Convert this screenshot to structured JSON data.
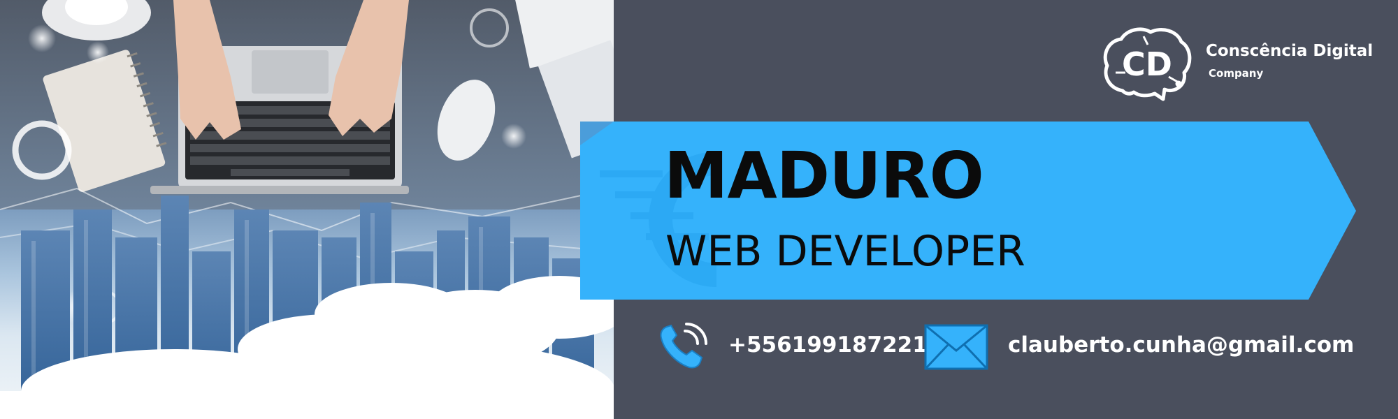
{
  "headline": {
    "name": "MADURO",
    "role": "WEB DEVELOPER"
  },
  "company": {
    "name": "Conscência Digital",
    "tagline": "Company",
    "logo_letters": "CD"
  },
  "contact": {
    "phone": "+5561991872219",
    "email": "clauberto.cunha@gmail.com"
  },
  "icons": {
    "phone": "phone-icon",
    "email": "envelope-icon",
    "logo": "brain-logo-icon"
  },
  "colors": {
    "background": "#4a4f5d",
    "accent_blue": "#35b2fb",
    "text_dark": "#0b0b0b",
    "text_light": "#ffffff"
  }
}
